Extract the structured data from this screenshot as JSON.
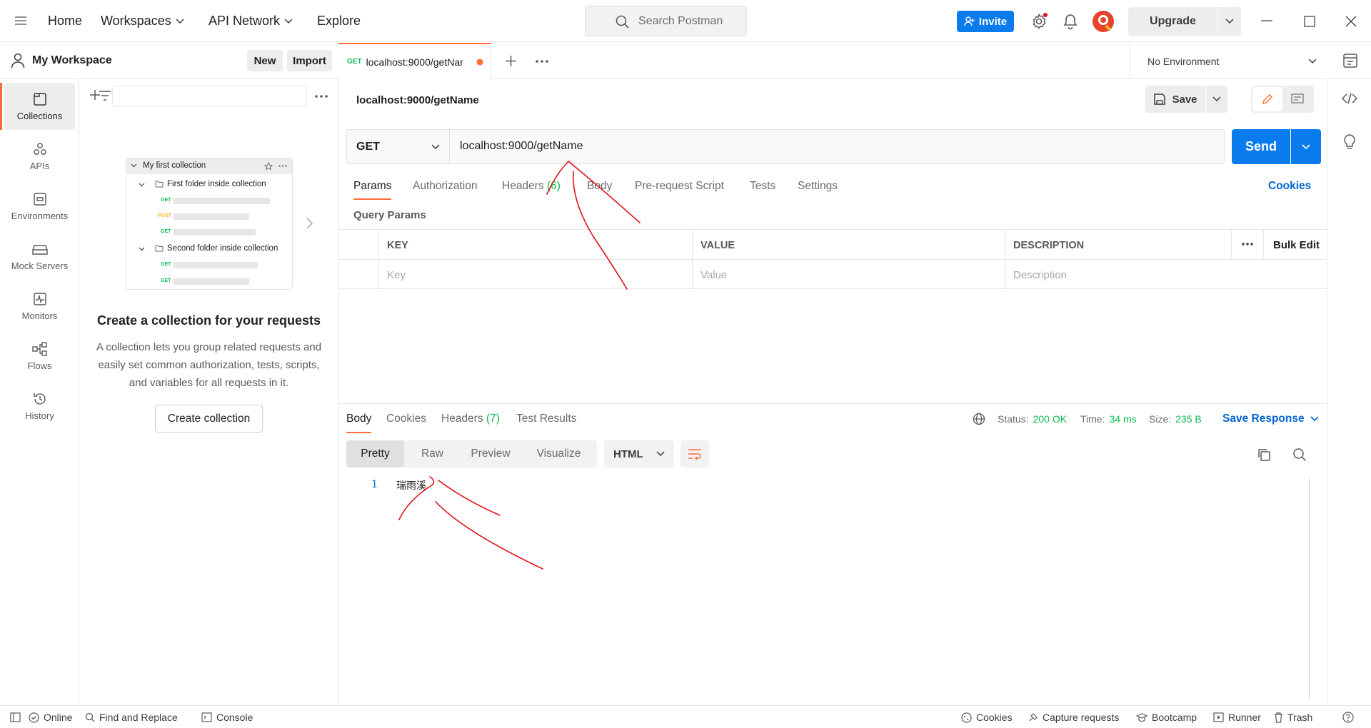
{
  "topbar": {
    "nav": [
      "Home",
      "Workspaces",
      "API Network",
      "Explore"
    ],
    "search_placeholder": "Search Postman",
    "invite_label": "Invite",
    "upgrade_label": "Upgrade"
  },
  "workspace": {
    "name": "My Workspace",
    "new_label": "New",
    "import_label": "Import"
  },
  "rail": [
    {
      "label": "Collections",
      "icon": "collections-icon"
    },
    {
      "label": "APIs",
      "icon": "apis-icon"
    },
    {
      "label": "Environments",
      "icon": "environments-icon"
    },
    {
      "label": "Mock Servers",
      "icon": "mock-servers-icon"
    },
    {
      "label": "Monitors",
      "icon": "monitors-icon"
    },
    {
      "label": "Flows",
      "icon": "flows-icon"
    },
    {
      "label": "History",
      "icon": "history-icon"
    }
  ],
  "preview": {
    "collection": "My first collection",
    "folder1": "First folder inside collection",
    "folder2": "Second folder inside collection",
    "get": "GET",
    "post": "POST"
  },
  "empty_state": {
    "title": "Create a collection for your requests",
    "description": "A collection lets you group related requests and easily set common authorization, tests, scripts, and variables for all requests in it.",
    "button": "Create collection"
  },
  "tab": {
    "method": "GET",
    "title": "localhost:9000/getNar"
  },
  "environment": "No Environment",
  "request": {
    "name": "localhost:9000/getName",
    "save_label": "Save",
    "method": "GET",
    "url": "localhost:9000/getName",
    "send_label": "Send",
    "tabs": [
      "Params",
      "Authorization",
      "Headers",
      "Body",
      "Pre-request Script",
      "Tests",
      "Settings"
    ],
    "headers_count": "(6)",
    "cookies_label": "Cookies",
    "query_params_title": "Query Params",
    "columns": [
      "KEY",
      "VALUE",
      "DESCRIPTION"
    ],
    "bulk_edit": "Bulk Edit",
    "placeholders": [
      "Key",
      "Value",
      "Description"
    ]
  },
  "response": {
    "tabs": [
      "Body",
      "Cookies",
      "Headers",
      "Test Results"
    ],
    "headers_count": "(7)",
    "status_label": "Status:",
    "status_value": "200 OK",
    "time_label": "Time:",
    "time_value": "34 ms",
    "size_label": "Size:",
    "size_value": "235 B",
    "save_response": "Save Response",
    "formats": [
      "Pretty",
      "Raw",
      "Preview",
      "Visualize"
    ],
    "language": "HTML",
    "line_number": "1",
    "body": "瑞雨溪"
  },
  "statusbar": {
    "online": "Online",
    "find_replace": "Find and Replace",
    "console": "Console",
    "cookies": "Cookies",
    "capture": "Capture requests",
    "bootcamp": "Bootcamp",
    "runner": "Runner",
    "trash": "Trash"
  },
  "colors": {
    "accent": "#ff6c37",
    "primary": "#097bed",
    "success": "#0cbb52",
    "annotation": "#e0101a"
  }
}
